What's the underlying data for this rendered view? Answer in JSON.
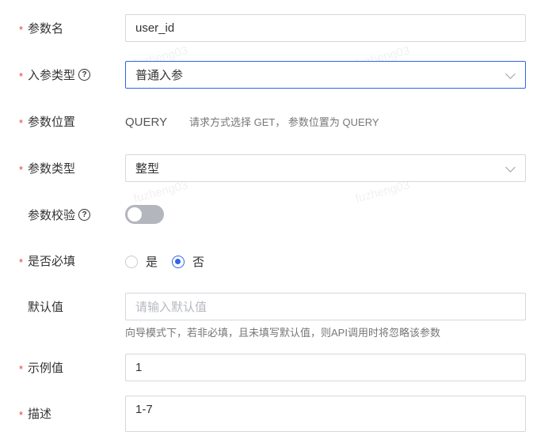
{
  "form": {
    "param_name": {
      "label": "参数名",
      "required": true,
      "value": "user_id"
    },
    "param_in_type": {
      "label": "入参类型",
      "required": true,
      "help": "?",
      "value": "普通入参",
      "chevron_icon": "chevron-down-icon"
    },
    "param_position": {
      "label": "参数位置",
      "required": true,
      "value": "QUERY",
      "hint": "请求方式选择 GET， 参数位置为 QUERY"
    },
    "param_type": {
      "label": "参数类型",
      "required": true,
      "value": "整型",
      "chevron_icon": "chevron-down-icon"
    },
    "param_validation": {
      "label": "参数校验",
      "required": false,
      "help": "?",
      "enabled": false
    },
    "is_required": {
      "label": "是否必填",
      "required": true,
      "options": [
        "是",
        "否"
      ],
      "selected": "否"
    },
    "default_value": {
      "label": "默认值",
      "required": false,
      "placeholder": "请输入默认值",
      "hint": "向导模式下，若非必填，且未填写默认值，则API调用时将忽略该参数"
    },
    "example_value": {
      "label": "示例值",
      "required": true,
      "value": "1"
    },
    "description": {
      "label": "描述",
      "required": true,
      "value": "1-7"
    }
  },
  "required_mark": "*",
  "watermark_text": "fuzheng03",
  "colors": {
    "accent": "#2f64e8",
    "required": "#e63b3b",
    "border": "#d4d7de",
    "toggle_off": "#b3b6bd"
  }
}
